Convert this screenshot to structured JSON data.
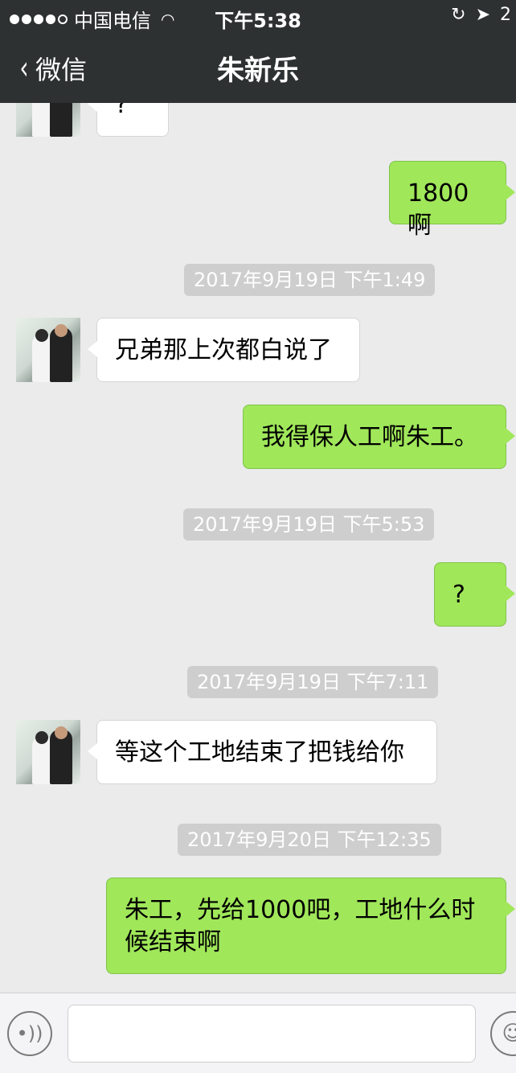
{
  "status_bar": {
    "carrier": "中国电信",
    "time": "下午5:38",
    "battery_partial": "2"
  },
  "nav": {
    "back_label": "微信",
    "title": "朱新乐"
  },
  "messages": [
    {
      "side": "left",
      "text": "?"
    },
    {
      "side": "right",
      "text": "1800啊"
    },
    {
      "type": "time",
      "text": "2017年9月19日 下午1:49"
    },
    {
      "side": "left",
      "text": "兄弟那上次都白说了"
    },
    {
      "side": "right",
      "text": "我得保人工啊朱工。"
    },
    {
      "type": "time",
      "text": "2017年9月19日 下午5:53"
    },
    {
      "side": "right",
      "text": "?"
    },
    {
      "type": "time",
      "text": "2017年9月19日 下午7:11"
    },
    {
      "side": "left",
      "text": "等这个工地结束了把钱给你"
    },
    {
      "type": "time",
      "text": "2017年9月20日 下午12:35"
    },
    {
      "side": "right",
      "text": "朱工，先给1000吧，工地什么时候结束啊"
    }
  ],
  "input": {
    "value": "",
    "voice_icon": "voice-icon",
    "emoji_icon": "emoji-icon"
  },
  "colors": {
    "nav_bg": "#2e3132",
    "chat_bg": "#ebebeb",
    "bubble_right": "#a0e75a",
    "bubble_left": "#ffffff",
    "timestamp_bg": "#cecece"
  }
}
